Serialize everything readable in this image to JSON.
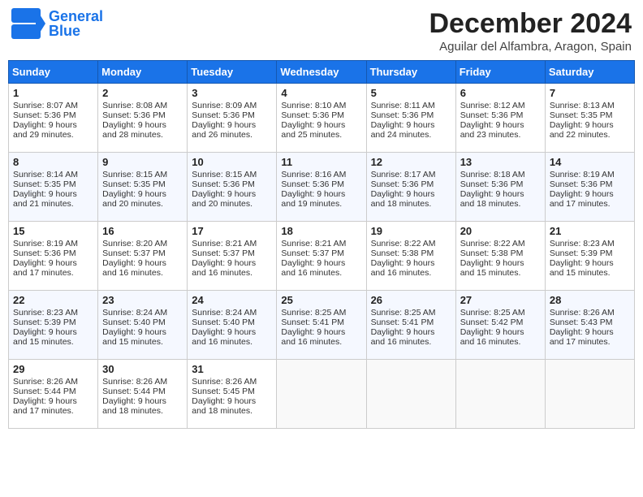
{
  "header": {
    "logo_general": "General",
    "logo_blue": "Blue",
    "month_title": "December 2024",
    "location": "Aguilar del Alfambra, Aragon, Spain"
  },
  "weekdays": [
    "Sunday",
    "Monday",
    "Tuesday",
    "Wednesday",
    "Thursday",
    "Friday",
    "Saturday"
  ],
  "weeks": [
    [
      {
        "day": "1",
        "lines": [
          "Sunrise: 8:07 AM",
          "Sunset: 5:36 PM",
          "Daylight: 9 hours",
          "and 29 minutes."
        ]
      },
      {
        "day": "2",
        "lines": [
          "Sunrise: 8:08 AM",
          "Sunset: 5:36 PM",
          "Daylight: 9 hours",
          "and 28 minutes."
        ]
      },
      {
        "day": "3",
        "lines": [
          "Sunrise: 8:09 AM",
          "Sunset: 5:36 PM",
          "Daylight: 9 hours",
          "and 26 minutes."
        ]
      },
      {
        "day": "4",
        "lines": [
          "Sunrise: 8:10 AM",
          "Sunset: 5:36 PM",
          "Daylight: 9 hours",
          "and 25 minutes."
        ]
      },
      {
        "day": "5",
        "lines": [
          "Sunrise: 8:11 AM",
          "Sunset: 5:36 PM",
          "Daylight: 9 hours",
          "and 24 minutes."
        ]
      },
      {
        "day": "6",
        "lines": [
          "Sunrise: 8:12 AM",
          "Sunset: 5:36 PM",
          "Daylight: 9 hours",
          "and 23 minutes."
        ]
      },
      {
        "day": "7",
        "lines": [
          "Sunrise: 8:13 AM",
          "Sunset: 5:35 PM",
          "Daylight: 9 hours",
          "and 22 minutes."
        ]
      }
    ],
    [
      {
        "day": "8",
        "lines": [
          "Sunrise: 8:14 AM",
          "Sunset: 5:35 PM",
          "Daylight: 9 hours",
          "and 21 minutes."
        ]
      },
      {
        "day": "9",
        "lines": [
          "Sunrise: 8:15 AM",
          "Sunset: 5:35 PM",
          "Daylight: 9 hours",
          "and 20 minutes."
        ]
      },
      {
        "day": "10",
        "lines": [
          "Sunrise: 8:15 AM",
          "Sunset: 5:36 PM",
          "Daylight: 9 hours",
          "and 20 minutes."
        ]
      },
      {
        "day": "11",
        "lines": [
          "Sunrise: 8:16 AM",
          "Sunset: 5:36 PM",
          "Daylight: 9 hours",
          "and 19 minutes."
        ]
      },
      {
        "day": "12",
        "lines": [
          "Sunrise: 8:17 AM",
          "Sunset: 5:36 PM",
          "Daylight: 9 hours",
          "and 18 minutes."
        ]
      },
      {
        "day": "13",
        "lines": [
          "Sunrise: 8:18 AM",
          "Sunset: 5:36 PM",
          "Daylight: 9 hours",
          "and 18 minutes."
        ]
      },
      {
        "day": "14",
        "lines": [
          "Sunrise: 8:19 AM",
          "Sunset: 5:36 PM",
          "Daylight: 9 hours",
          "and 17 minutes."
        ]
      }
    ],
    [
      {
        "day": "15",
        "lines": [
          "Sunrise: 8:19 AM",
          "Sunset: 5:36 PM",
          "Daylight: 9 hours",
          "and 17 minutes."
        ]
      },
      {
        "day": "16",
        "lines": [
          "Sunrise: 8:20 AM",
          "Sunset: 5:37 PM",
          "Daylight: 9 hours",
          "and 16 minutes."
        ]
      },
      {
        "day": "17",
        "lines": [
          "Sunrise: 8:21 AM",
          "Sunset: 5:37 PM",
          "Daylight: 9 hours",
          "and 16 minutes."
        ]
      },
      {
        "day": "18",
        "lines": [
          "Sunrise: 8:21 AM",
          "Sunset: 5:37 PM",
          "Daylight: 9 hours",
          "and 16 minutes."
        ]
      },
      {
        "day": "19",
        "lines": [
          "Sunrise: 8:22 AM",
          "Sunset: 5:38 PM",
          "Daylight: 9 hours",
          "and 16 minutes."
        ]
      },
      {
        "day": "20",
        "lines": [
          "Sunrise: 8:22 AM",
          "Sunset: 5:38 PM",
          "Daylight: 9 hours",
          "and 15 minutes."
        ]
      },
      {
        "day": "21",
        "lines": [
          "Sunrise: 8:23 AM",
          "Sunset: 5:39 PM",
          "Daylight: 9 hours",
          "and 15 minutes."
        ]
      }
    ],
    [
      {
        "day": "22",
        "lines": [
          "Sunrise: 8:23 AM",
          "Sunset: 5:39 PM",
          "Daylight: 9 hours",
          "and 15 minutes."
        ]
      },
      {
        "day": "23",
        "lines": [
          "Sunrise: 8:24 AM",
          "Sunset: 5:40 PM",
          "Daylight: 9 hours",
          "and 15 minutes."
        ]
      },
      {
        "day": "24",
        "lines": [
          "Sunrise: 8:24 AM",
          "Sunset: 5:40 PM",
          "Daylight: 9 hours",
          "and 16 minutes."
        ]
      },
      {
        "day": "25",
        "lines": [
          "Sunrise: 8:25 AM",
          "Sunset: 5:41 PM",
          "Daylight: 9 hours",
          "and 16 minutes."
        ]
      },
      {
        "day": "26",
        "lines": [
          "Sunrise: 8:25 AM",
          "Sunset: 5:41 PM",
          "Daylight: 9 hours",
          "and 16 minutes."
        ]
      },
      {
        "day": "27",
        "lines": [
          "Sunrise: 8:25 AM",
          "Sunset: 5:42 PM",
          "Daylight: 9 hours",
          "and 16 minutes."
        ]
      },
      {
        "day": "28",
        "lines": [
          "Sunrise: 8:26 AM",
          "Sunset: 5:43 PM",
          "Daylight: 9 hours",
          "and 17 minutes."
        ]
      }
    ],
    [
      {
        "day": "29",
        "lines": [
          "Sunrise: 8:26 AM",
          "Sunset: 5:44 PM",
          "Daylight: 9 hours",
          "and 17 minutes."
        ]
      },
      {
        "day": "30",
        "lines": [
          "Sunrise: 8:26 AM",
          "Sunset: 5:44 PM",
          "Daylight: 9 hours",
          "and 18 minutes."
        ]
      },
      {
        "day": "31",
        "lines": [
          "Sunrise: 8:26 AM",
          "Sunset: 5:45 PM",
          "Daylight: 9 hours",
          "and 18 minutes."
        ]
      },
      null,
      null,
      null,
      null
    ]
  ]
}
